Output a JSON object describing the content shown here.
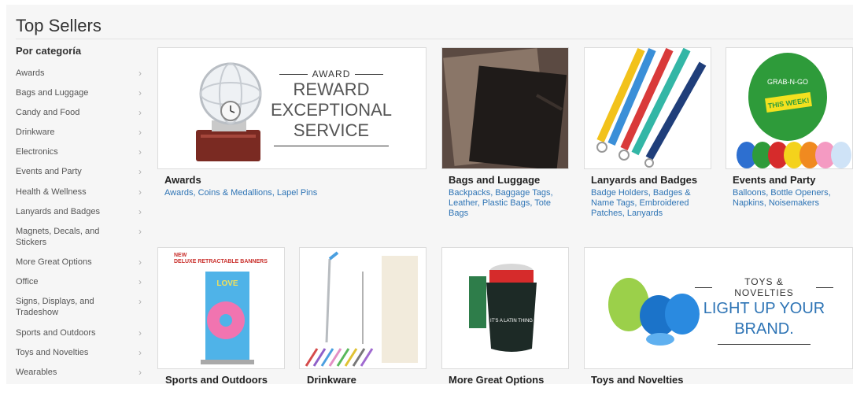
{
  "page": {
    "title": "Top Sellers"
  },
  "sidebar": {
    "heading": "Por categoría",
    "items": [
      {
        "label": "Awards"
      },
      {
        "label": "Bags and Luggage"
      },
      {
        "label": "Candy and Food"
      },
      {
        "label": "Drinkware"
      },
      {
        "label": "Electronics"
      },
      {
        "label": "Events and Party"
      },
      {
        "label": "Health & Wellness"
      },
      {
        "label": "Lanyards and Badges"
      },
      {
        "label": "Magnets, Decals, and Stickers"
      },
      {
        "label": "More Great Options"
      },
      {
        "label": "Office"
      },
      {
        "label": "Signs, Displays, and Tradeshow"
      },
      {
        "label": "Sports and Outdoors"
      },
      {
        "label": "Toys and Novelties"
      },
      {
        "label": "Wearables"
      }
    ],
    "chevron": "›"
  },
  "promos": {
    "award": {
      "kicker": "AWARD",
      "line1": "REWARD",
      "line2": "EXCEPTIONAL",
      "line3": "SERVICE"
    },
    "toys": {
      "kicker": "TOYS & NOVELTIES",
      "line1": "LIGHT UP YOUR",
      "line2": "BRAND."
    },
    "banner_caption": "NEW\nDELUXE RETRACTABLE BANNERS",
    "banner_word": "LOVE",
    "balloon_brand": "GRAB-N-GO",
    "balloon_tag": "THIS WEEK!",
    "koozie_text": "IT'S A LATIN THING"
  },
  "categories": {
    "awards": {
      "title": "Awards",
      "links": "Awards, Coins & Medallions, Lapel Pins"
    },
    "bags": {
      "title": "Bags and Luggage",
      "links": "Backpacks, Baggage Tags, Leather, Plastic Bags, Tote Bags"
    },
    "lanyards": {
      "title": "Lanyards and Badges",
      "links": "Badge Holders, Badges & Name Tags, Embroidered Patches, Lanyards"
    },
    "events": {
      "title": "Events and Party",
      "links": "Balloons, Bottle Openers, Napkins, Noisemakers"
    },
    "sports": {
      "title": "Sports and Outdoors"
    },
    "drinkware": {
      "title": "Drinkware"
    },
    "more": {
      "title": "More Great Options"
    },
    "toys": {
      "title": "Toys and Novelties"
    }
  },
  "colors": {
    "link": "#2e74b5",
    "balloon_green": "#2e9b3a"
  }
}
